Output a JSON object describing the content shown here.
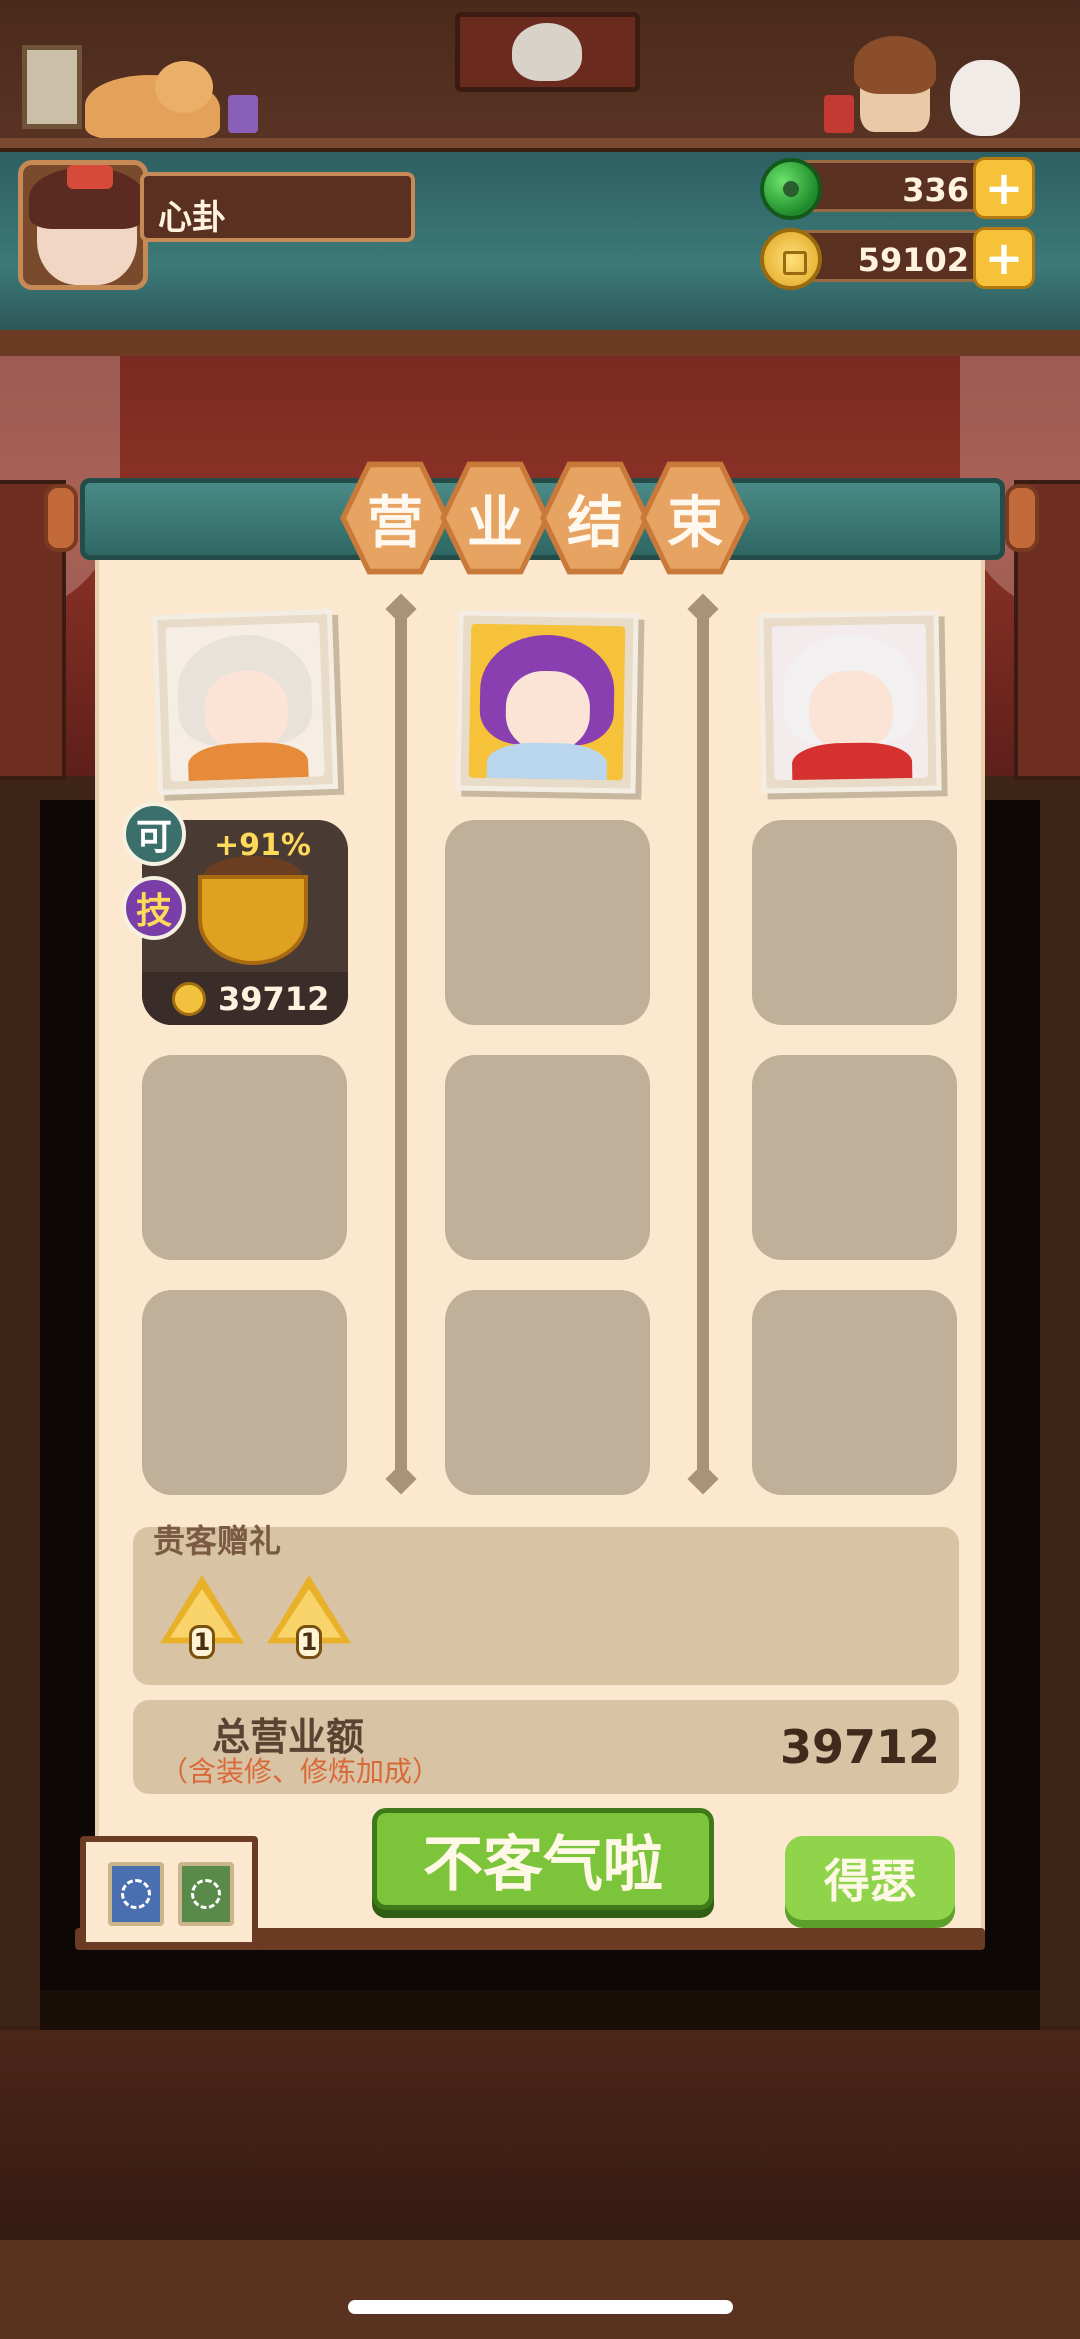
{
  "player": {
    "name": "心卦"
  },
  "currency": {
    "jade": "336",
    "coins": "59102",
    "plus_icon": "plus-icon"
  },
  "result": {
    "title_chars": [
      "营",
      "业",
      "结",
      "束"
    ],
    "dish": {
      "bonus": "+91%",
      "price": "39712",
      "badge_top": "可",
      "badge_bottom": "技"
    },
    "gift_title": "贵客赠礼",
    "gifts": [
      {
        "count": "1"
      },
      {
        "count": "1"
      }
    ],
    "total_label": "总营业额",
    "total_sub": "（含装修、修炼加成）",
    "total_value": "39712",
    "main_button": "不客气啦",
    "side_button": "得瑟"
  },
  "colors": {
    "panel_bg": "#fbe8cf",
    "banner": "#3c7a76",
    "button_green": "#7cc43a",
    "slot": "#c1b099",
    "accent_gold": "#f6c23a"
  }
}
